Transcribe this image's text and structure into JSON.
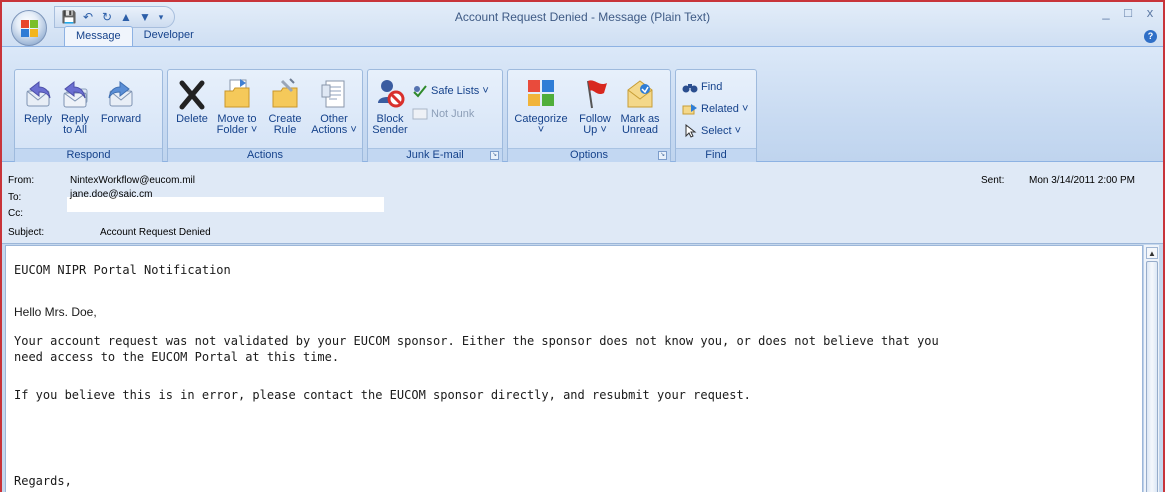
{
  "window": {
    "title": "Account Request Denied - Message (Plain Text)",
    "controls": [
      "_",
      "□",
      "x"
    ]
  },
  "qat": {
    "icons": [
      "save-icon",
      "undo-icon",
      "redo-icon",
      "up-icon",
      "down-icon",
      "customize-icon"
    ]
  },
  "tabs": [
    {
      "label": "Message",
      "active": true
    },
    {
      "label": "Developer",
      "active": false
    }
  ],
  "ribbon": {
    "groups": {
      "respond": {
        "label": "Respond",
        "buttons": [
          {
            "line1": "Reply",
            "line2": "",
            "icon": "reply-icon"
          },
          {
            "line1": "Reply",
            "line2": "to All",
            "icon": "reply-all-icon"
          },
          {
            "line1": "Forward",
            "line2": "",
            "icon": "forward-icon"
          }
        ]
      },
      "actions": {
        "label": "Actions",
        "buttons": [
          {
            "line1": "Delete",
            "line2": "",
            "icon": "delete-icon"
          },
          {
            "line1": "Move to",
            "line2": "Folder ˅",
            "icon": "move-folder-icon"
          },
          {
            "line1": "Create",
            "line2": "Rule",
            "icon": "create-rule-icon"
          },
          {
            "line1": "Other",
            "line2": "Actions ˅",
            "icon": "other-actions-icon"
          }
        ]
      },
      "junk": {
        "label": "Junk E-mail",
        "block_line1": "Block",
        "block_line2": "Sender",
        "safe_lists": "Safe Lists ˅",
        "not_junk": "Not Junk"
      },
      "options": {
        "label": "Options",
        "buttons": [
          {
            "line1": "Categorize",
            "line2": "˅",
            "icon": "categorize-icon"
          },
          {
            "line1": "Follow",
            "line2": "Up ˅",
            "icon": "follow-up-flag-icon"
          },
          {
            "line1": "Mark as",
            "line2": "Unread",
            "icon": "mark-unread-icon"
          }
        ]
      },
      "find": {
        "label": "Find",
        "items": [
          "Find",
          "Related ˅",
          "Select ˅"
        ]
      }
    }
  },
  "header": {
    "from_label": "From:",
    "from_value": "NintexWorkflow@eucom.mil",
    "to_label": "To:",
    "to_value": "jane.doe@saic.cm",
    "cc_label": "Cc:",
    "subject_label": "Subject:",
    "subject_value": "Account Request Denied",
    "sent_label": "Sent:",
    "sent_value": "Mon 3/14/2011 2:00 PM"
  },
  "body": {
    "lines": [
      "EUCOM NIPR Portal Notification",
      "Hello Mrs. Doe,",
      "Your account request was not validated by your EUCOM sponsor. Either the sponsor does not know you, or does not believe that you",
      "need access to the EUCOM Portal at this time.",
      "If you believe this is in error, please contact the EUCOM sponsor directly, and resubmit your request.",
      "Regards,"
    ]
  }
}
